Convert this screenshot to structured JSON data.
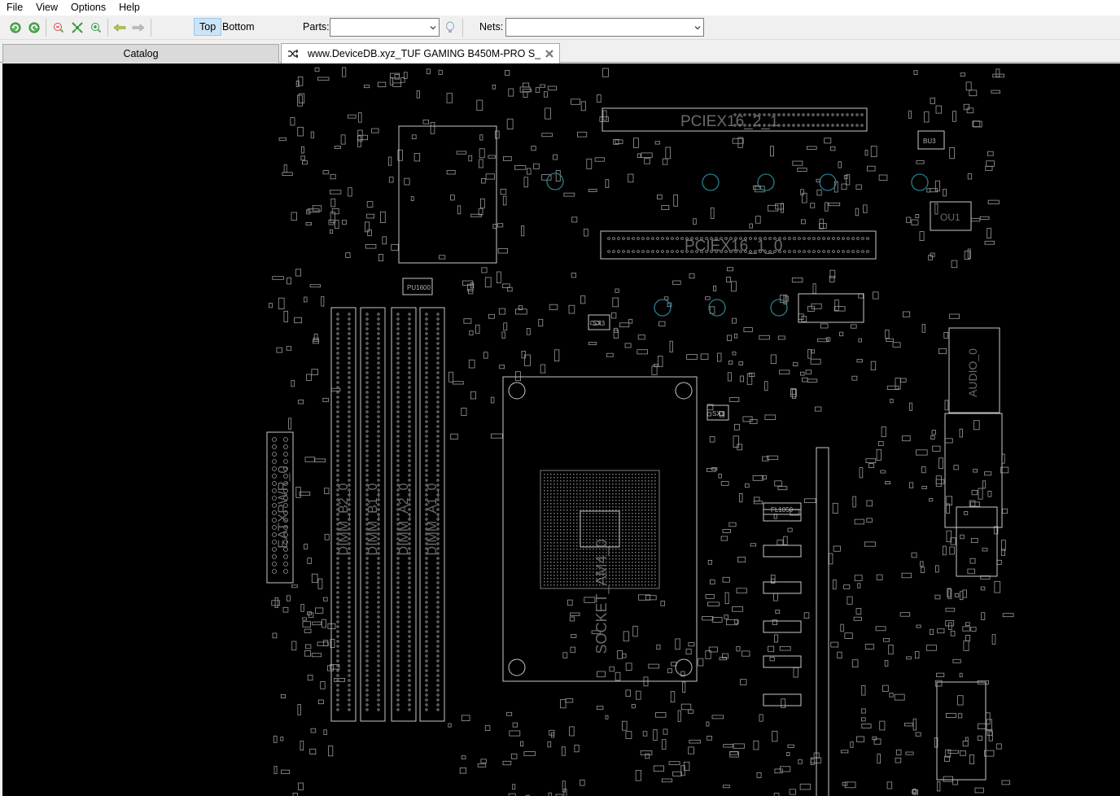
{
  "menu": {
    "file": "File",
    "view": "View",
    "options": "Options",
    "help": "Help"
  },
  "toolbar": {
    "icons": [
      "rotate-left-icon",
      "rotate-right-icon",
      "zoom-out-icon",
      "zoom-fit-icon",
      "zoom-in-icon",
      "back-arrow-icon",
      "forward-arrow-icon"
    ],
    "top_label": "Top",
    "bottom_label": "Bottom",
    "parts_label": "Parts:",
    "parts_value": "",
    "nets_label": "Nets:",
    "nets_value": "",
    "active_side": "Top"
  },
  "tabs": {
    "catalog": "Catalog",
    "document": "www.DeviceDB.xyz_TUF GAMING B450M-PRO S_"
  },
  "board": {
    "labels": {
      "pciex16_2": "PCIEX16_2_1",
      "pciex16_1": "PCIEX16_1_0",
      "socket": "SOCKET_AM4_0",
      "eatxpwr": "EATXPWR_0",
      "dimm_b2": "DIMM_B2_0",
      "dimm_b1": "DIMM_B1_0",
      "dimm_a2": "DIMM_A2_0",
      "dimm_a1": "DIMM_A1_0",
      "audio": "AUDIO_0",
      "ou1": "OU1",
      "bu3": "BU3",
      "sx1": "SX1",
      "sx3": "SX3",
      "pu1600": "PU1600",
      "fl1050": "FL1050"
    },
    "colors": {
      "background": "#000000",
      "silkscreen": "#c8c8c8",
      "mounting_hole": "#2a7f8a"
    }
  }
}
